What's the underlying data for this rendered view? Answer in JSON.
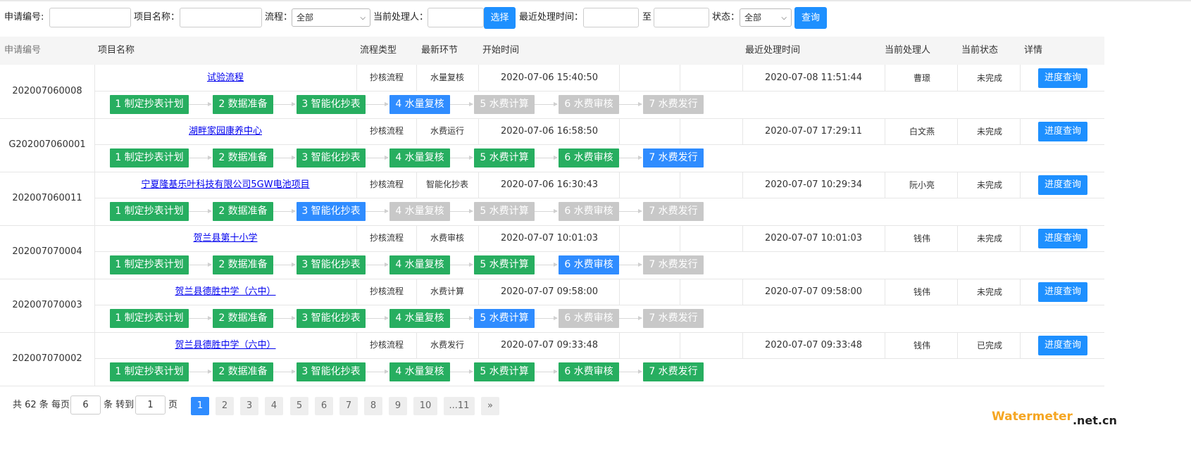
{
  "filters": {
    "app_no_label": "申请编号:",
    "project_name_label": "项目名称：",
    "flow_label": "流程：",
    "flow_value": "全部",
    "handler_label": "当前处理人：",
    "select_btn": "选择",
    "recent_time_label": "最近处理时间：",
    "to_label": "至",
    "status_label": "状态：",
    "status_value": "全部",
    "query_btn": "查询"
  },
  "table": {
    "headers": [
      "申请编号",
      "项目名称",
      "流程类型",
      "最新环节",
      "开始时间",
      "最近处理时间",
      "当前处理人",
      "当前状态",
      "详情"
    ],
    "detail_btn": "进度查询",
    "step_names": [
      "1 制定抄表计划",
      "2 数据准备",
      "3 智能化抄表",
      "4 水量复核",
      "5 水费计算",
      "6 水费审核",
      "7 水费发行"
    ],
    "rows": [
      {
        "app_no": "202007060008",
        "project": "试验流程",
        "flow": "抄核流程",
        "step": "水量复核",
        "start": "2020-07-06 15:40:50",
        "recent": "2020-07-08 11:51:44",
        "person": "曹璟",
        "status": "未完成",
        "progress": 4
      },
      {
        "app_no": "G202007060001",
        "project": "湖畔家园康养中心",
        "flow": "抄核流程",
        "step": "水费运行",
        "start": "2020-07-06 16:58:50",
        "recent": "2020-07-07 17:29:11",
        "person": "白文燕",
        "status": "未完成",
        "progress": 7
      },
      {
        "app_no": "202007060011",
        "project": "宁夏隆基乐叶科技有限公司5GW电池项目",
        "flow": "抄核流程",
        "step": "智能化抄表",
        "start": "2020-07-06 16:30:43",
        "recent": "2020-07-07 10:29:34",
        "person": "阮小亮",
        "status": "未完成",
        "progress": 3
      },
      {
        "app_no": "202007070004",
        "project": "贺兰县第十小学",
        "flow": "抄核流程",
        "step": "水费审核",
        "start": "2020-07-07 10:01:03",
        "recent": "2020-07-07 10:01:03",
        "person": "钱伟",
        "status": "未完成",
        "progress": 6
      },
      {
        "app_no": "202007070003",
        "project": "贺兰县德胜中学（六中）",
        "flow": "抄核流程",
        "step": "水费计算",
        "start": "2020-07-07 09:58:00",
        "recent": "2020-07-07 09:58:00",
        "person": "钱伟",
        "status": "未完成",
        "progress": 5
      },
      {
        "app_no": "202007070002",
        "project": "贺兰县德胜中学（六中）",
        "flow": "抄核流程",
        "step": "水费发行",
        "start": "2020-07-07 09:33:48",
        "recent": "2020-07-07 09:33:48",
        "person": "钱伟",
        "status": "已完成",
        "progress": 8
      }
    ]
  },
  "pager": {
    "total_prefix": "共 62 条 每页",
    "per_page": "6",
    "jump_label": "条 转到",
    "jump_value": "1",
    "page_label": "页",
    "pages": [
      "1",
      "2",
      "3",
      "4",
      "5",
      "6",
      "7",
      "8",
      "9",
      "10",
      "...11",
      "»"
    ],
    "active_page": "1"
  },
  "watermark": {
    "a": "Watermeter",
    "b": ".net.cn"
  }
}
